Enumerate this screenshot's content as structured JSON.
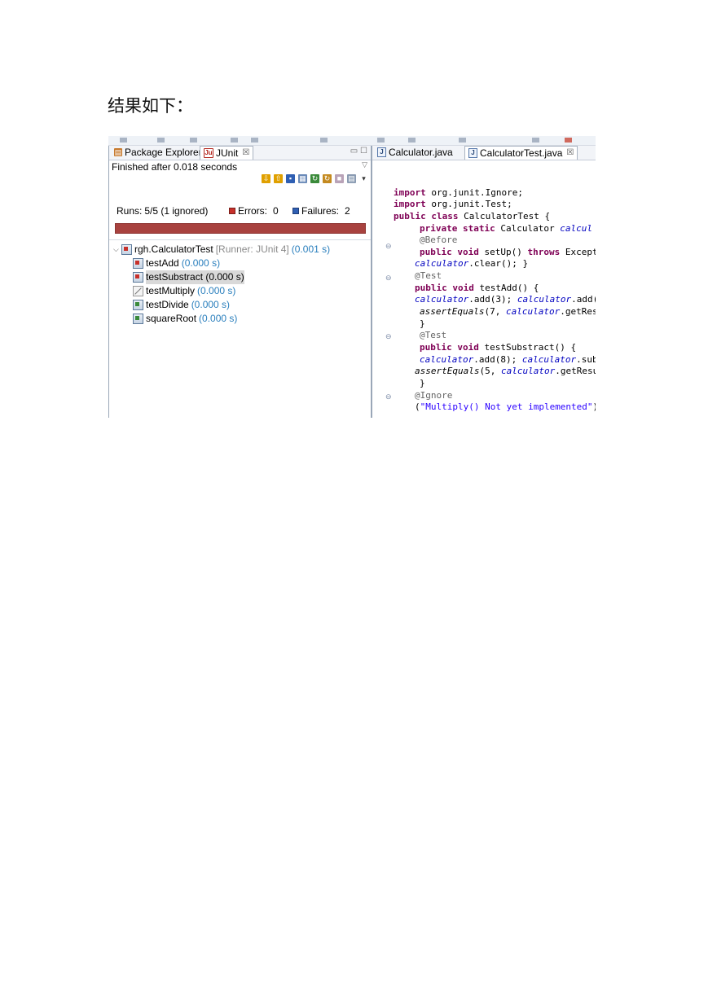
{
  "heading": "结果如下：",
  "left_panel": {
    "tabs": [
      {
        "label": "Package Explorer"
      },
      {
        "label": "JUnit",
        "close": "☒"
      }
    ],
    "status": "Finished after 0.018 seconds",
    "counters": {
      "runs_label": "Runs:",
      "runs_value": "5/5 (1 ignored)",
      "errors_label": "Errors:",
      "errors_value": "0",
      "failures_label": "Failures:",
      "failures_value": "2"
    },
    "progress_color": "#a8423f",
    "tree": {
      "root": {
        "label": "rgh.CalculatorTest",
        "runner": "[Runner: JUnit 4]",
        "time": "(0.001 s)"
      },
      "items": [
        {
          "label": "testAdd",
          "time": "(0.000 s)",
          "status": "failed",
          "icon": "test-fail-icon"
        },
        {
          "label": "testSubstract",
          "time": "(0.000 s)",
          "status": "failed",
          "icon": "test-fail-icon",
          "selected": true
        },
        {
          "label": "testMultiply",
          "time": "(0.000 s)",
          "status": "ignored",
          "icon": "test-ignored-icon"
        },
        {
          "label": "testDivide",
          "time": "(0.000 s)",
          "status": "passed",
          "icon": "test-pass-icon"
        },
        {
          "label": "squareRoot",
          "time": "(0.000 s)",
          "status": "passed",
          "icon": "test-pass-icon"
        }
      ]
    }
  },
  "editor": {
    "tabs": [
      {
        "label": "Calculator.java"
      },
      {
        "label": "CalculatorTest.java",
        "close": "☒"
      }
    ],
    "code": {
      "l1": {
        "kw": "import",
        "rest": " org.junit.Ignore;"
      },
      "l2": {
        "kw": "import",
        "rest": " org.junit.Test;"
      },
      "l3": {
        "kw": "public class",
        "rest": " CalculatorTest {"
      },
      "l4": {
        "kw": "private static",
        "rest": " Calculator ",
        "field": "calcul"
      },
      "l5": {
        "ann": "@Before"
      },
      "l6": {
        "kw": "public void",
        "rest": " setUp() ",
        "kw2": "throws",
        "rest2": " Except"
      },
      "l7": {
        "field": "calculator",
        "rest": ".clear(); }"
      },
      "l8": {
        "ann": "@Test"
      },
      "l9": {
        "kw": "public void",
        "rest": " testAdd() {"
      },
      "l10": {
        "field": "calculator",
        "rest": ".add(3); ",
        "field2": "calculator",
        "rest2": ".add("
      },
      "l11": {
        "static": "assertEquals",
        "rest": "(7, ",
        "field": "calculator",
        "rest2": ".getRes"
      },
      "l12": {
        "rest": "}"
      },
      "l13": {
        "ann": "@Test"
      },
      "l14": {
        "kw": "public void",
        "rest": " testSubstract() {"
      },
      "l15": {
        "field": "calculator",
        "rest": ".add(8); ",
        "field2": "calculator",
        "rest2": ".sub"
      },
      "l16": {
        "static": "assertEquals",
        "rest": "(5, ",
        "field": "calculator",
        "rest2": ".getResu"
      },
      "l17": {
        "rest": "}"
      },
      "l18": {
        "ann": "@Ignore"
      },
      "l19": {
        "rest": "(",
        "str": "\"Multiply() Not yet implemented\"",
        "rest2": ")"
      }
    },
    "fold_marker": "⊖"
  }
}
